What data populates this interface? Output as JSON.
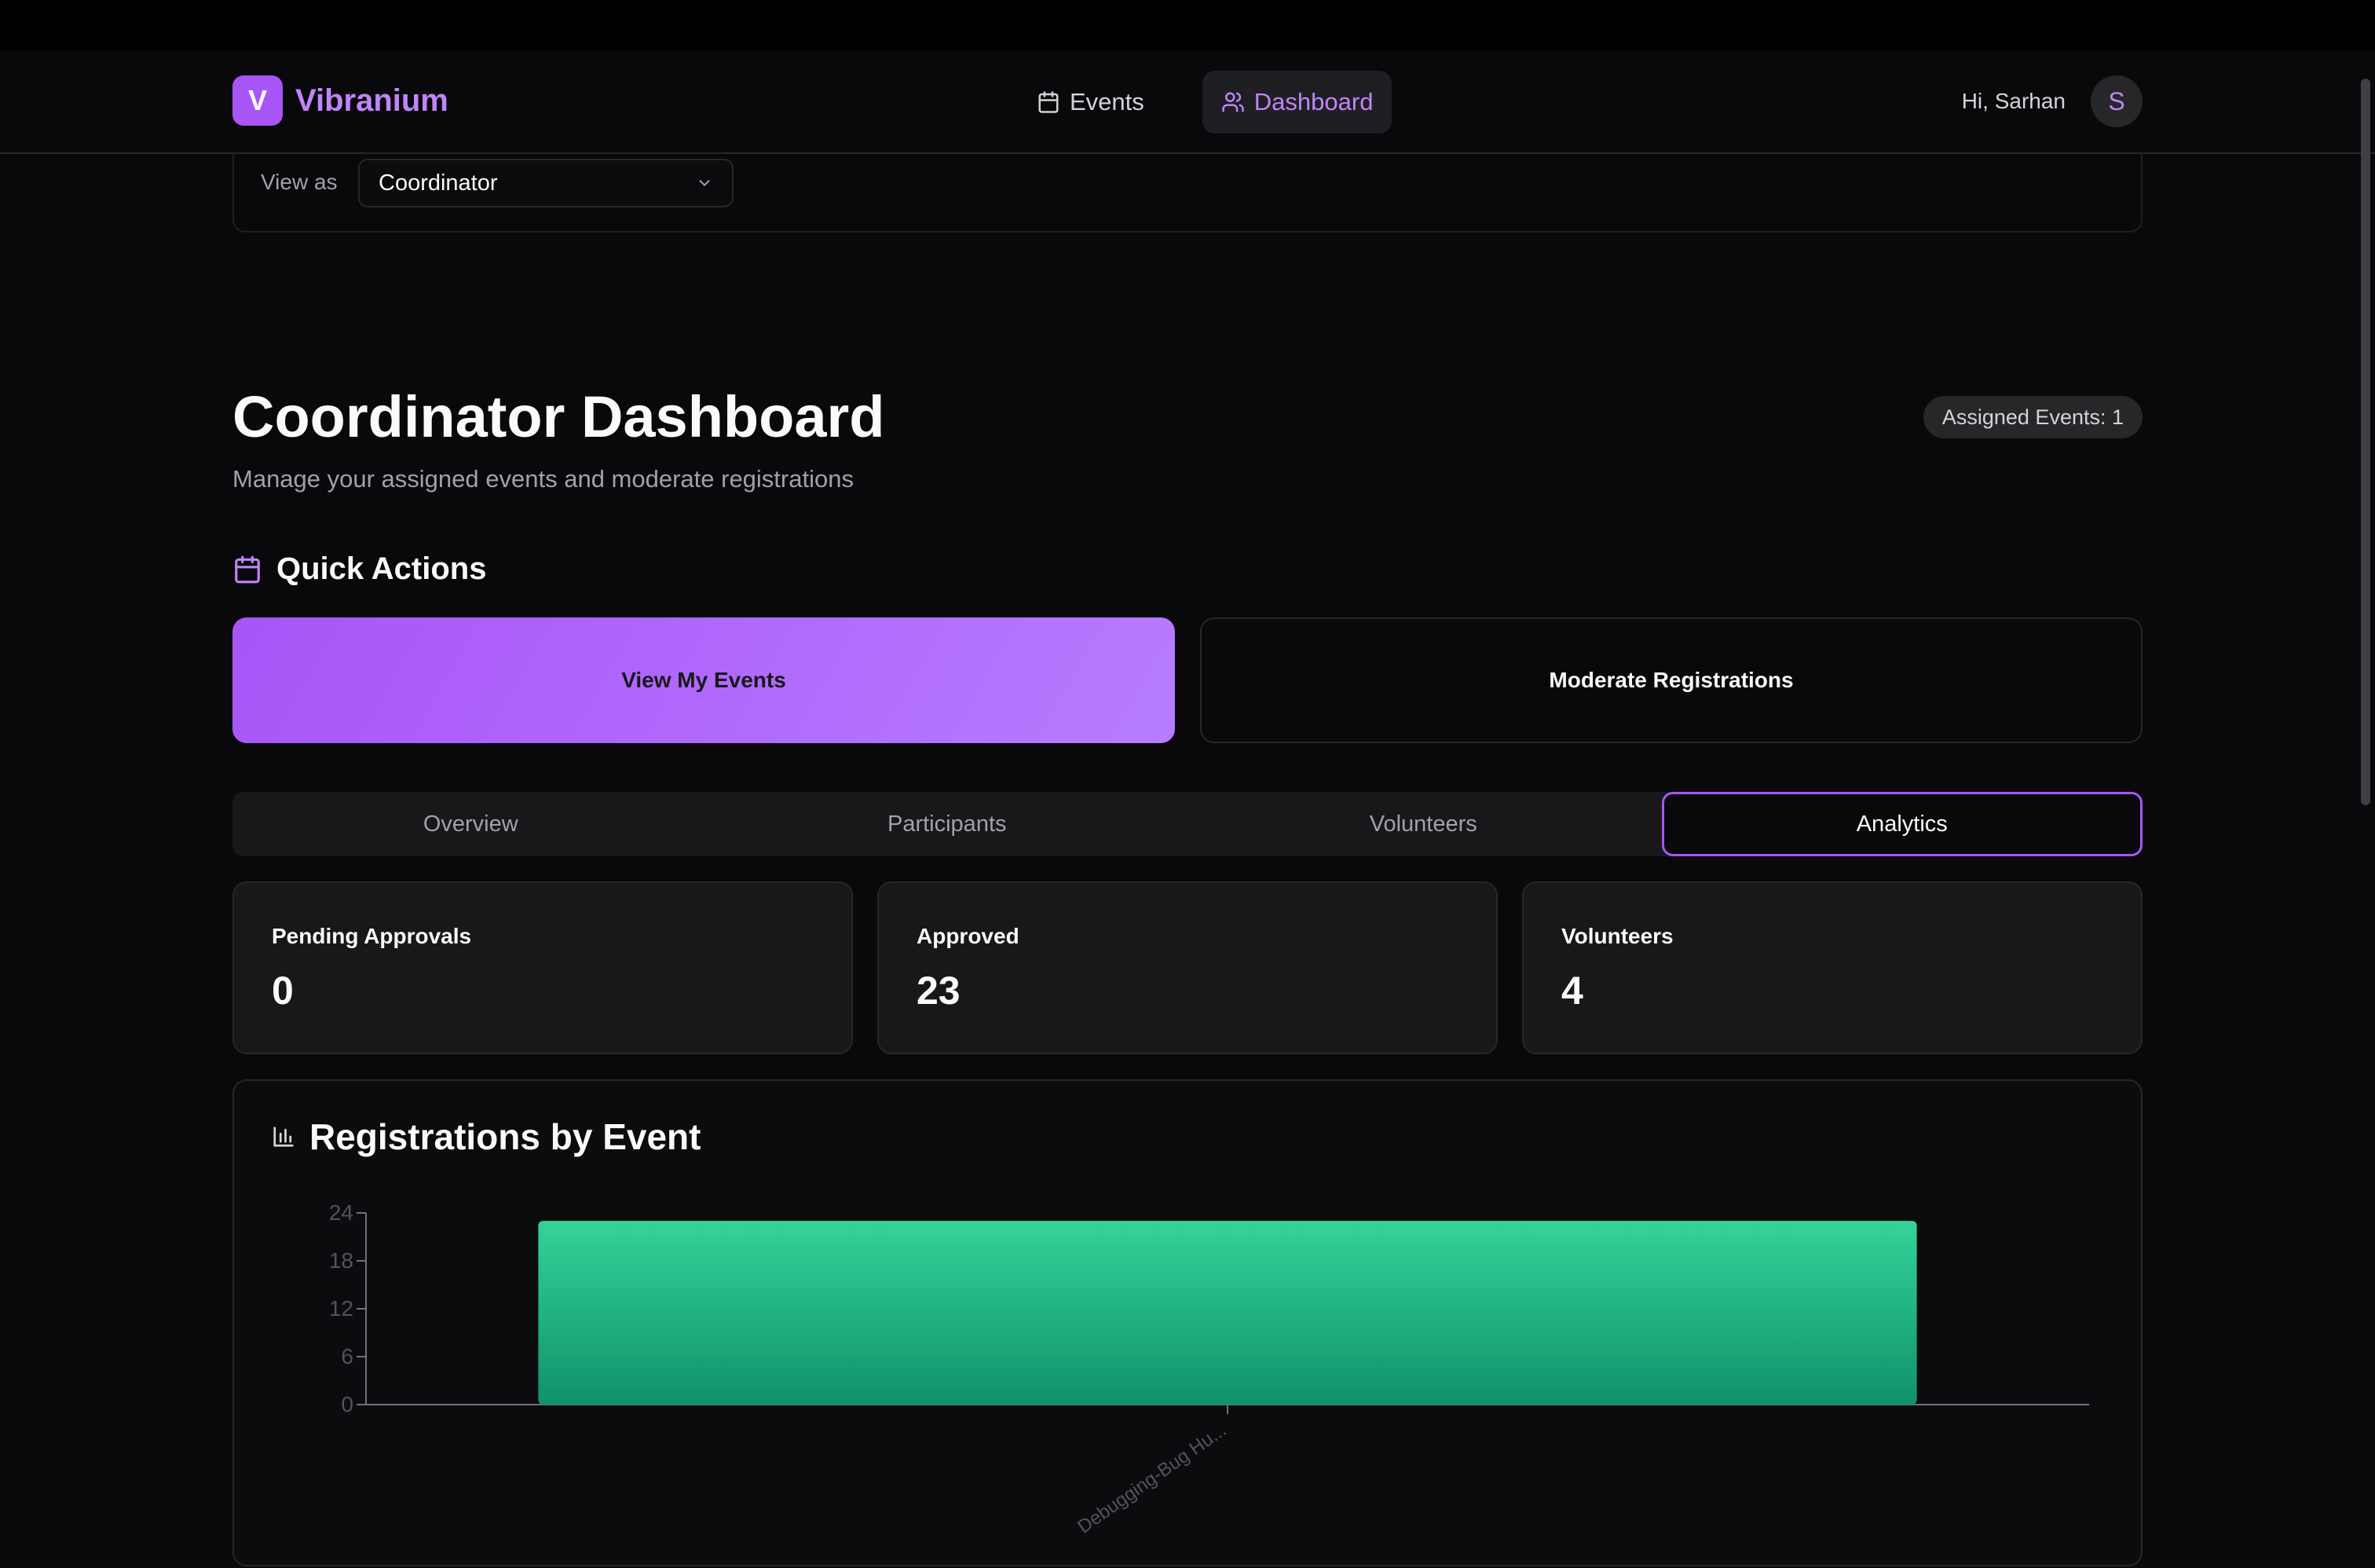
{
  "brand": {
    "logo_letter": "V",
    "name": "Vibranium",
    "accent": "#a855f7"
  },
  "nav": {
    "events_label": "Events",
    "dashboard_label": "Dashboard"
  },
  "user": {
    "greeting": "Hi, Sarhan",
    "avatar_letter": "S"
  },
  "view_as": {
    "label": "View as",
    "selected": "Coordinator"
  },
  "page": {
    "title": "Coordinator Dashboard",
    "subtitle": "Manage your assigned events and moderate registrations",
    "assigned_badge": "Assigned Events: 1"
  },
  "quick_actions": {
    "heading": "Quick Actions",
    "primary_label": "View My Events",
    "secondary_label": "Moderate Registrations"
  },
  "tabs": [
    "Overview",
    "Participants",
    "Volunteers",
    "Analytics"
  ],
  "active_tab": "Analytics",
  "stats": [
    {
      "label": "Pending Approvals",
      "value": "0"
    },
    {
      "label": "Approved",
      "value": "23"
    },
    {
      "label": "Volunteers",
      "value": "4"
    }
  ],
  "chart_card": {
    "title": "Registrations by Event"
  },
  "chart_data": {
    "type": "bar",
    "categories": [
      "Debugging-Bug Hu..."
    ],
    "values": [
      23
    ],
    "title": "Registrations by Event",
    "xlabel": "",
    "ylabel": "",
    "ylim": [
      0,
      24
    ],
    "yticks": [
      0,
      6,
      12,
      18,
      24
    ],
    "grid": false,
    "bar_color_top": "#34d399",
    "bar_color_bottom": "#10916b"
  }
}
